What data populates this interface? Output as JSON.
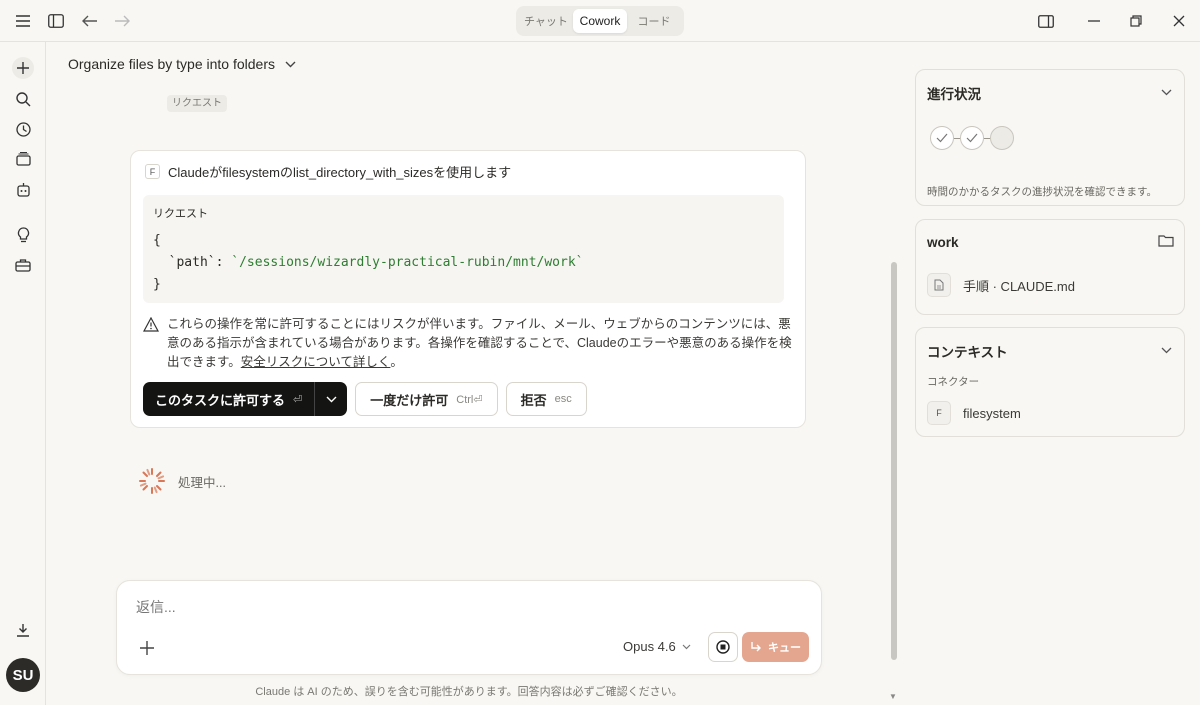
{
  "topbar": {
    "tabs": [
      {
        "label": "チャット",
        "active": false
      },
      {
        "label": "Cowork",
        "active": true
      },
      {
        "label": "コード",
        "active": false
      }
    ]
  },
  "sidebar": {
    "avatar_initials": "SU"
  },
  "main": {
    "task_title": "Organize files by type into folders",
    "request_chip": "リクエスト",
    "tool_card": {
      "badge": "F",
      "header": "Claudeがfilesystemのlist_directory_with_sizesを使用します",
      "code_label": "リクエスト",
      "code_open": "{",
      "code_key": "  `path`: ",
      "code_value": "`/sessions/wizardly-practical-rubin/mnt/work`",
      "code_close": "}",
      "warning_text": "これらの操作を常に許可することにはリスクが伴います。ファイル、メール、ウェブからのコンテンツには、悪意のある指示が含まれている場合があります。各操作を確認することで、Claudeのエラーや悪意のある操作を検出できます。",
      "warning_link": "安全リスクについて詳しく",
      "warning_end": "。",
      "allow_task_label": "このタスクに許可する",
      "allow_task_shortcut": "⏎",
      "allow_once_label": "一度だけ許可",
      "allow_once_shortcut": "Ctrl⏎",
      "deny_label": "拒否",
      "deny_shortcut": "esc"
    },
    "processing_text": "処理中..."
  },
  "composer": {
    "placeholder": "返信...",
    "model": "Opus 4.6",
    "queue_label": "キュー"
  },
  "disclaimer": "Claude は AI のため、誤りを含む可能性があります。回答内容は必ずご確認ください。",
  "right_panel": {
    "progress": {
      "title": "進行状況",
      "steps": [
        "done",
        "done",
        "pending"
      ],
      "description": "時間のかかるタスクの進捗状況を確認できます。"
    },
    "work": {
      "title": "work",
      "file": "手順 · CLAUDE.md"
    },
    "context": {
      "title": "コンテキスト",
      "connectors_label": "コネクター",
      "connector_badge": "F",
      "connector_name": "filesystem"
    }
  },
  "colors": {
    "accent": "#e5a68f",
    "primary_button": "#141413",
    "code_string": "#2e7d32",
    "spinner": "#d97757"
  }
}
